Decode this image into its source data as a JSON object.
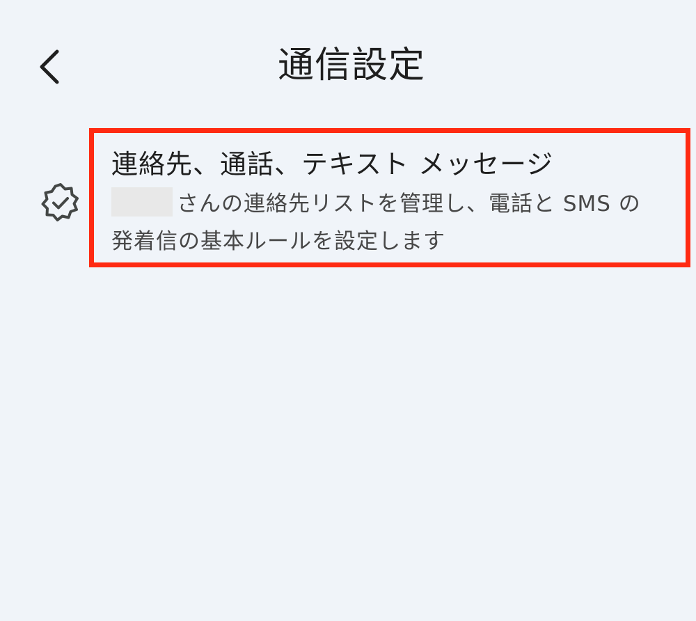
{
  "header": {
    "title": "通信設定",
    "back_icon": "chevron-left-icon"
  },
  "settings_item": {
    "icon": "verified-badge-icon",
    "title": "連絡先、通話、テキスト メッセージ",
    "description_line1": "さんの連絡先リストを管理し、電話と SMS の",
    "description_line2": "発着信の基本ルールを設定します",
    "highlight_color": "#ff2a12"
  },
  "colors": {
    "background": "#f0f4f9",
    "text_primary": "#1f1f1f",
    "text_secondary": "#474747"
  }
}
